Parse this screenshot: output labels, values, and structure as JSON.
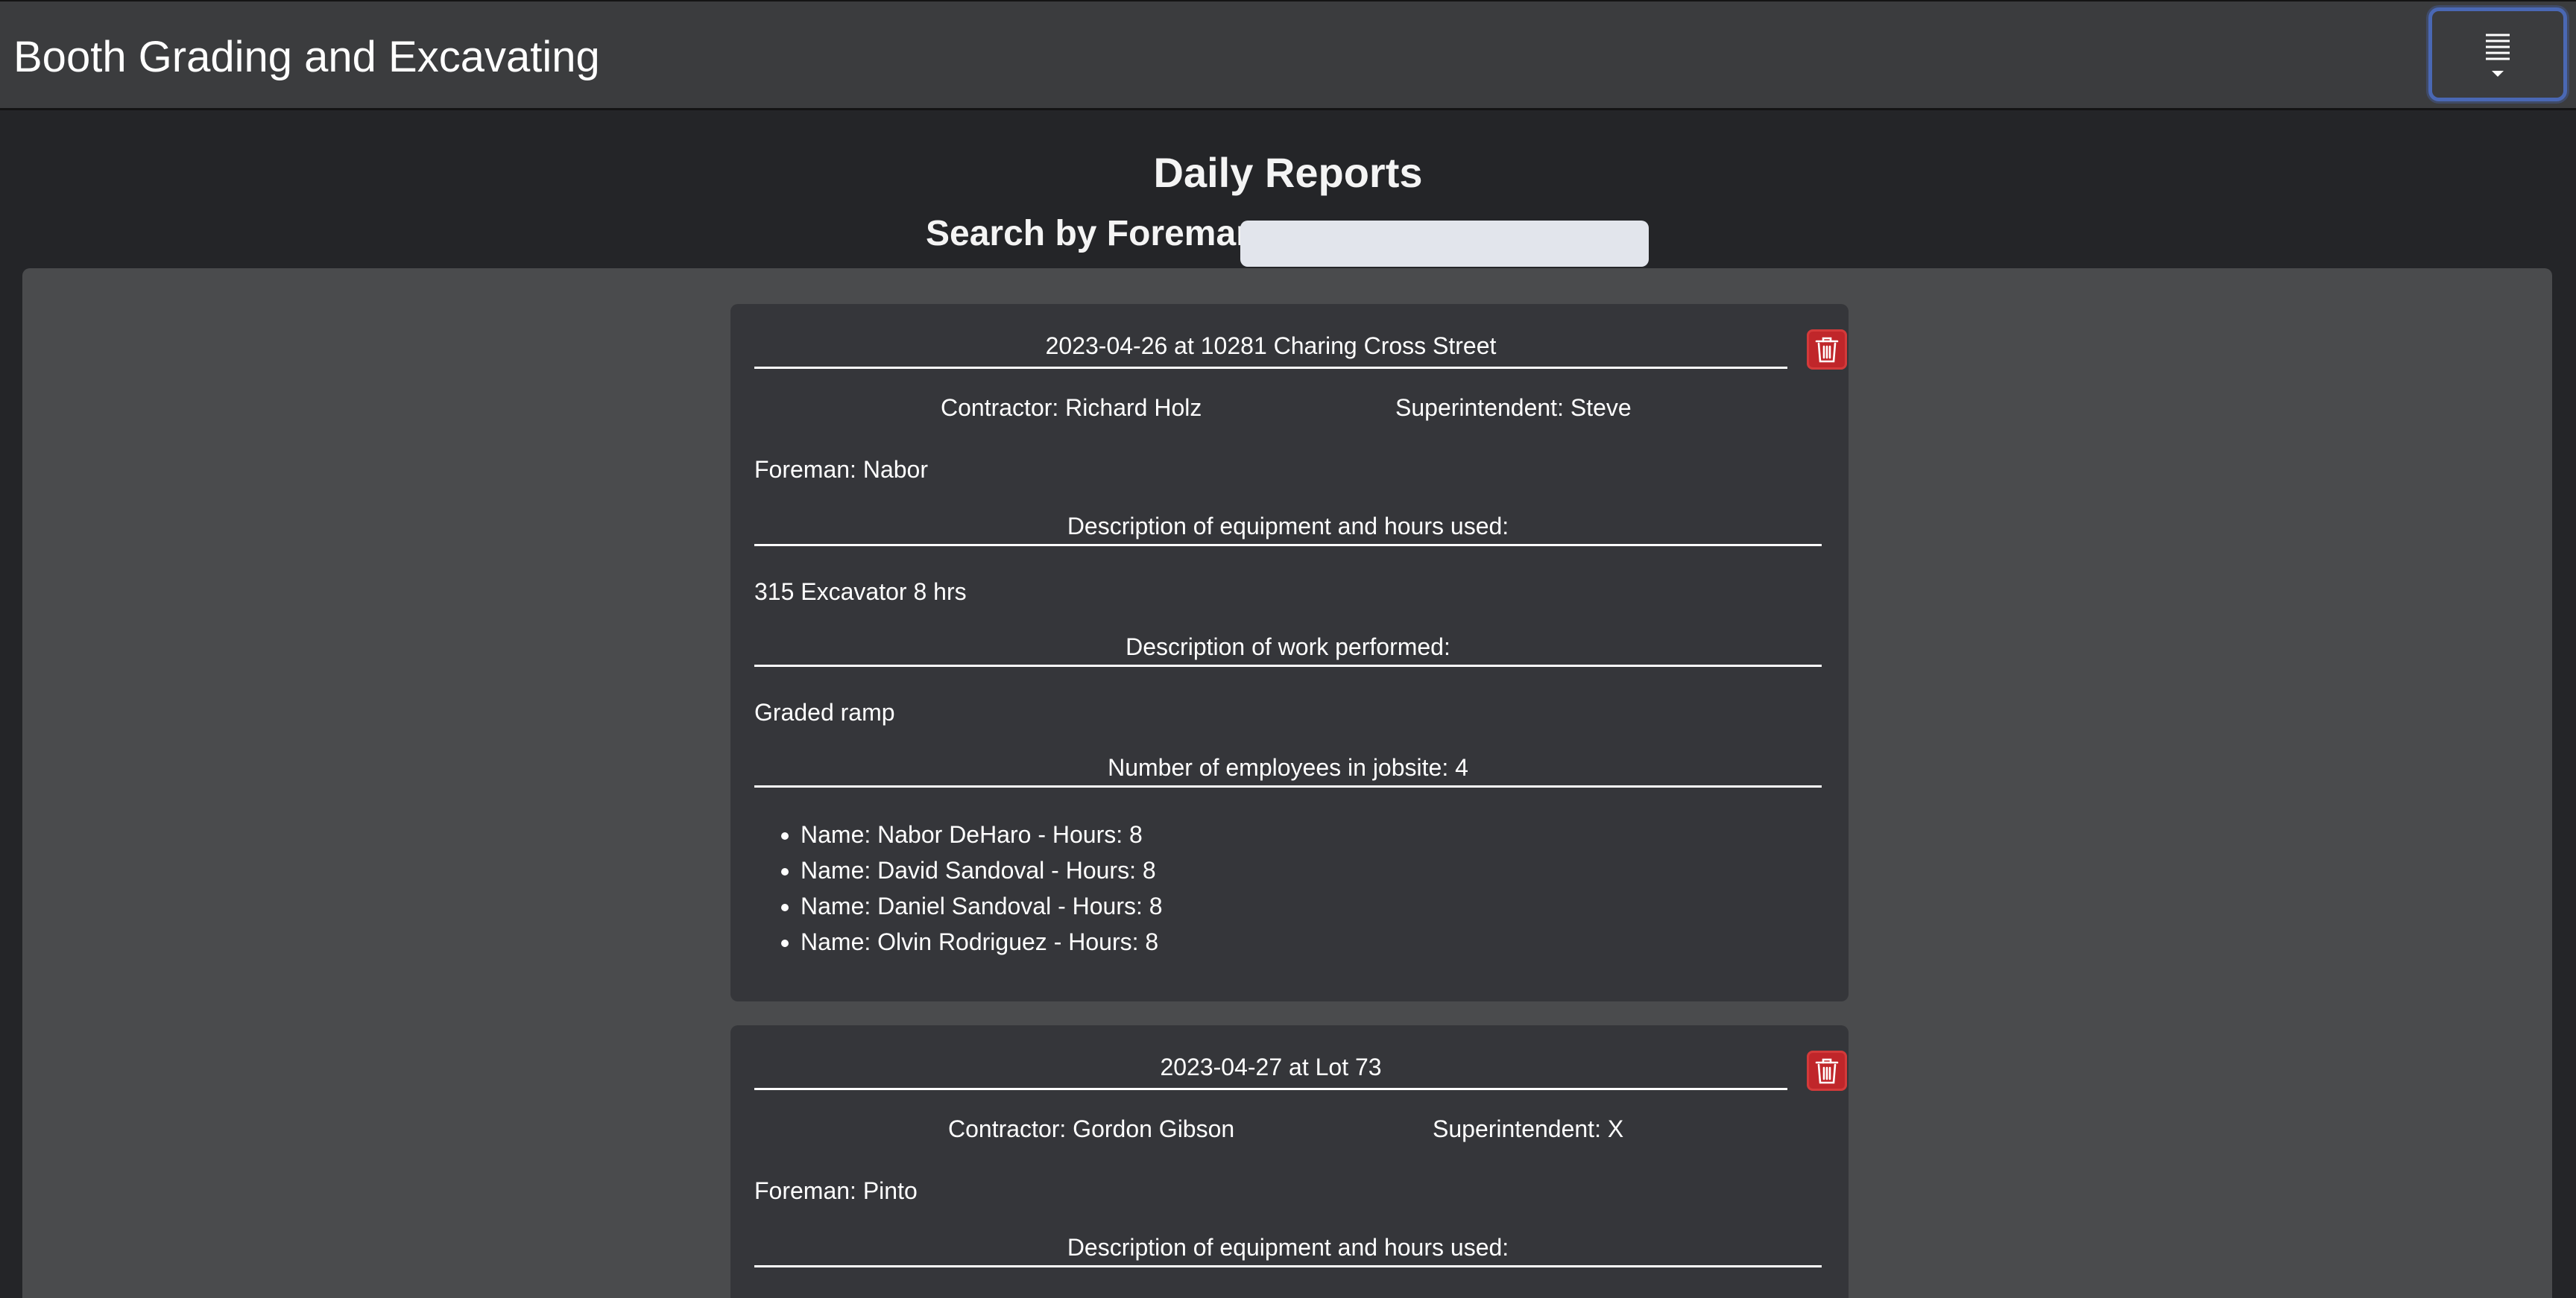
{
  "header": {
    "brand": "Booth Grading and Excavating",
    "menu_icon": "hamburger-icon"
  },
  "page": {
    "title": "Daily Reports",
    "search_label": "Search by Foreman",
    "search_value": "",
    "search_placeholder": ""
  },
  "reports": [
    {
      "title": "2023-04-26 at 10281 Charing Cross Street",
      "contractor": "Contractor: Richard Holz",
      "superintendent": "Superintendent: Steve",
      "foreman": "Foreman: Nabor",
      "equipment_heading": "Description of equipment and hours used:",
      "equipment": "315 Excavator 8 hrs",
      "work_heading": "Description of work performed:",
      "work": "Graded ramp",
      "employees_heading": "Number of employees in jobsite: 4",
      "employees": [
        "Name: Nabor DeHaro - Hours: 8",
        "Name: David Sandoval - Hours: 8",
        "Name: Daniel Sandoval - Hours: 8",
        "Name: Olvin Rodriguez - Hours: 8"
      ]
    },
    {
      "title": "2023-04-27 at Lot 73",
      "contractor": "Contractor: Gordon Gibson",
      "superintendent": "Superintendent: X",
      "foreman": "Foreman: Pinto",
      "equipment_heading": "Description of equipment and hours used:"
    }
  ],
  "colors": {
    "navbar": "#3b3c3e",
    "page_bg": "#242528",
    "content_bg": "#4a4b4d",
    "card_bg": "#35363a",
    "delete_red": "#c0262a",
    "focus_blue": "#4a68b4"
  }
}
